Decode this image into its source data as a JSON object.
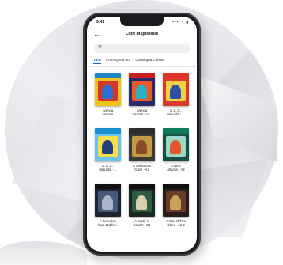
{
  "status": {
    "time": "9:41",
    "icons": "••• ◔ ▮"
  },
  "header": {
    "title": "Libri disponibili"
  },
  "search": {
    "placeholder": ""
  },
  "tabs": [
    {
      "label": "Tutti",
      "active": true
    },
    {
      "label": "Consegnati ora"
    },
    {
      "label": "Consegna Classe"
    }
  ],
  "books": [
    {
      "caption": "¡Venga\nVamos!",
      "colors": {
        "band": "#1e88c8",
        "bg": "#f1c21b",
        "art": "#d2382b",
        "art2": "#2b6fd0"
      }
    },
    {
      "caption": "¡Venga\nVamos! Co...",
      "colors": {
        "band": "#c8201c",
        "bg": "#2a2a6a",
        "art": "#e95a2a",
        "art2": "#28b3c4"
      }
    },
    {
      "caption": "1, 2, 3...\nMaturità - ...",
      "colors": {
        "band": "#e0312b",
        "bg": "#d93a2a",
        "art": "#f0d247",
        "art2": "#2c4fa3"
      }
    },
    {
      "caption": "1, 2, 3...\nMaturità - ...",
      "colors": {
        "band": "#1c8fd0",
        "bg": "#6cc3e8",
        "art": "#f5e04a",
        "art2": "#23407a"
      }
    },
    {
      "caption": "A Christmas\nCarol - A2",
      "colors": {
        "band": "#2d2d2d",
        "bg": "#3a3a38",
        "art": "#c29a42",
        "art2": "#8a4b2a"
      }
    },
    {
      "caption": "A New\nAtlantis - A2",
      "colors": {
        "band": "#0d7a5a",
        "bg": "#17513f",
        "art": "#9ed7c4",
        "art2": "#e3562d"
      }
    },
    {
      "caption": "A Selection\nfrom Dublin...",
      "colors": {
        "band": "#111111",
        "bg": "#1e2430",
        "art": "#445a78",
        "art2": "#a9b6c8"
      }
    },
    {
      "caption": "A Study in\nScarlet - B1",
      "colors": {
        "band": "#111111",
        "bg": "#1a2a22",
        "art": "#2f5a44",
        "art2": "#d6d0a8"
      }
    },
    {
      "caption": "A Tale of Two\nCities - A2.2",
      "colors": {
        "band": "#111111",
        "bg": "#2b1d1a",
        "art": "#6a3a2a",
        "art2": "#c9a25a"
      }
    }
  ]
}
